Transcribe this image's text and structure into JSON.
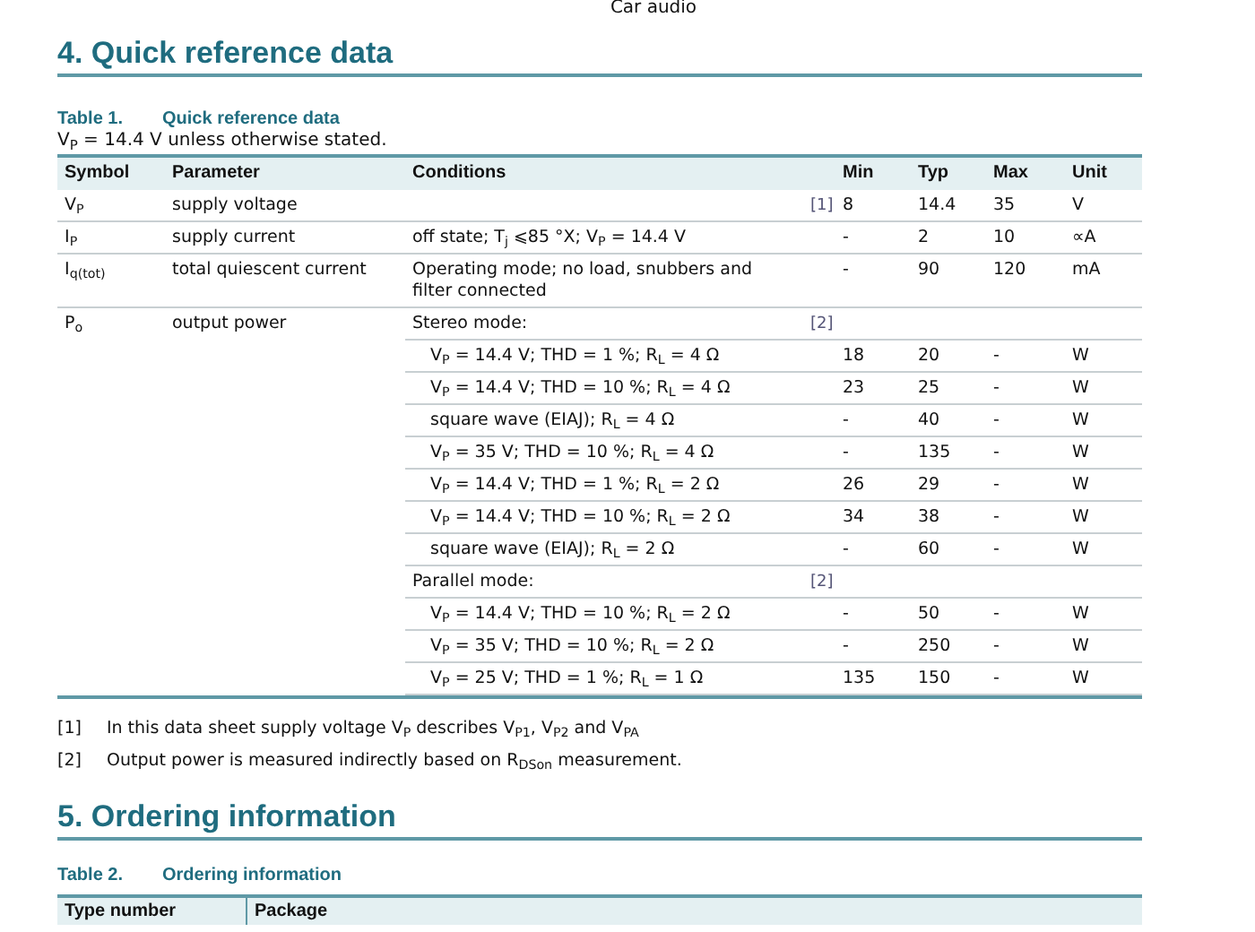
{
  "running_header": "Car audio",
  "section_4": {
    "heading": "4. Quick reference data",
    "table": {
      "label": "Table 1.",
      "title": "Quick reference data",
      "note": "V$_{P}$ = 14.4 V unless otherwise stated.",
      "columns": [
        "Symbol",
        "Parameter",
        "Conditions",
        "Min",
        "Typ",
        "Max",
        "Unit"
      ],
      "rows": [
        {
          "kind": "single",
          "symbol": "V$_{P}$",
          "parameter": "supply voltage",
          "conditions": "",
          "ref": "[1]",
          "min": "8",
          "typ": "14.4",
          "max": "35",
          "unit": "V"
        },
        {
          "kind": "single",
          "symbol": "I$_{P}$",
          "parameter": "supply current",
          "conditions": "off state; T$_{j}$ ⩽85 °X; V$_{P}$ = 14.4 V",
          "min": "-",
          "typ": "2",
          "max": "10",
          "unit": "∝A"
        },
        {
          "kind": "single",
          "symbol": "I$_{q(tot)}$",
          "parameter": "total quiescent current",
          "conditions": "Operating mode; no load, snubbers and filter connected",
          "min": "-",
          "typ": "90",
          "max": "120",
          "unit": "mA"
        },
        {
          "kind": "lead",
          "symbol": "P$_{o}$",
          "parameter": "output power",
          "conditions": "Stereo mode:",
          "ref": "[2]"
        },
        {
          "kind": "sub",
          "conditions": "V$_{P}$ = 14.4 V; THD = 1 %; R$_{L}$ = 4 Ω",
          "min": "18",
          "typ": "20",
          "max": "-",
          "unit": "W"
        },
        {
          "kind": "sub",
          "conditions": "V$_{P}$ = 14.4 V; THD = 10 %; R$_{L}$ = 4 Ω",
          "min": "23",
          "typ": "25",
          "max": "-",
          "unit": "W"
        },
        {
          "kind": "sub",
          "conditions": "square wave (EIAJ); R$_{L}$ = 4 Ω",
          "min": "-",
          "typ": "40",
          "max": "-",
          "unit": "W"
        },
        {
          "kind": "sub",
          "conditions": "V$_{P}$ = 35 V; THD = 10 %; R$_{L}$ = 4 Ω",
          "min": "-",
          "typ": "135",
          "max": "-",
          "unit": "W"
        },
        {
          "kind": "sub",
          "conditions": "V$_{P}$ = 14.4 V; THD = 1 %; R$_{L}$ = 2 Ω",
          "min": "26",
          "typ": "29",
          "max": "-",
          "unit": "W"
        },
        {
          "kind": "sub",
          "conditions": "V$_{P}$ = 14.4 V; THD = 10 %; R$_{L}$ = 2 Ω",
          "min": "34",
          "typ": "38",
          "max": "-",
          "unit": "W"
        },
        {
          "kind": "sub",
          "conditions": "square wave (EIAJ); R$_{L}$ = 2 Ω",
          "min": "-",
          "typ": "60",
          "max": "-",
          "unit": "W"
        },
        {
          "kind": "group",
          "conditions": "Parallel mode:",
          "ref": "[2]"
        },
        {
          "kind": "sub",
          "conditions": "V$_{P}$ = 14.4 V; THD = 10 %; R$_{L}$ = 2 Ω",
          "min": "-",
          "typ": "50",
          "max": "-",
          "unit": "W"
        },
        {
          "kind": "sub",
          "conditions": "V$_{P}$ = 35 V; THD = 10 %; R$_{L}$ = 2 Ω",
          "min": "-",
          "typ": "250",
          "max": "-",
          "unit": "W"
        },
        {
          "kind": "sub",
          "conditions": "V$_{P}$ = 25 V; THD = 1 %; R$_{L}$ = 1 Ω",
          "min": "135",
          "typ": "150",
          "max": "-",
          "unit": "W"
        }
      ]
    },
    "footnotes": [
      {
        "mark": "[1]",
        "text": "In this data sheet supply voltage V$_{P}$ describes V$_{P1}$, V$_{P2}$ and V$_{PA}$"
      },
      {
        "mark": "[2]",
        "text": "Output power is measured indirectly based on R$_{DSon}$ measurement."
      }
    ]
  },
  "section_5": {
    "heading": "5. Ordering information",
    "table": {
      "label": "Table 2.",
      "title": "Ordering information",
      "columns": [
        "Type number",
        "Package"
      ]
    }
  }
}
